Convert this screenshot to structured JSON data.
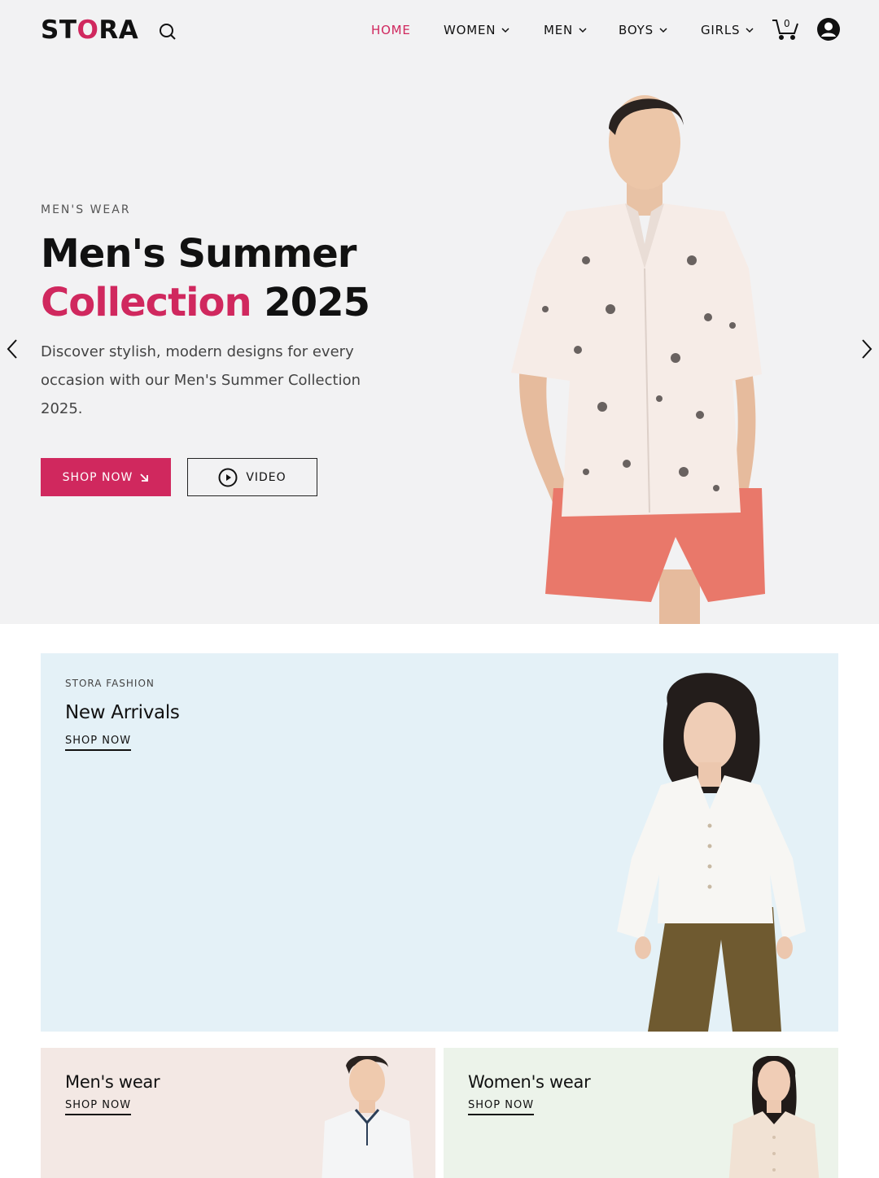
{
  "brand": {
    "prefix": "ST",
    "accent": "O",
    "suffix": "RA"
  },
  "nav": {
    "items": [
      {
        "label": "HOME",
        "active": true,
        "dropdown": false
      },
      {
        "label": "WOMEN",
        "active": false,
        "dropdown": true
      },
      {
        "label": "MEN",
        "active": false,
        "dropdown": true
      },
      {
        "label": "BOYS",
        "active": false,
        "dropdown": true
      },
      {
        "label": "GIRLS",
        "active": false,
        "dropdown": true
      }
    ],
    "cart_count": "0"
  },
  "hero": {
    "eyebrow": "MEN'S WEAR",
    "title_line1": "Men's Summer",
    "title_accent": "Collection",
    "title_year": "2025",
    "description": "Discover stylish, modern designs for every occasion with our Men's Summer Collection 2025.",
    "shop_label": "SHOP NOW",
    "video_label": "VIDEO"
  },
  "arrivals": {
    "eyebrow": "STORA FASHION",
    "title": "New Arrivals",
    "link": "SHOP NOW"
  },
  "cards": {
    "men": {
      "title": "Men's wear",
      "link": "SHOP NOW"
    },
    "women": {
      "title": "Women's wear",
      "link": "SHOP NOW"
    }
  },
  "colors": {
    "accent": "#d0285e",
    "hero_bg": "#f2f2f3",
    "arrivals_bg": "#e4f1f7",
    "men_card_bg": "#f3e8e4",
    "women_card_bg": "#ecf3ea"
  },
  "icons": [
    "search-icon",
    "chevron-down-icon",
    "cart-icon",
    "user-icon",
    "arrow-left-icon",
    "arrow-right-icon",
    "play-icon",
    "arrow-down-right-icon"
  ]
}
